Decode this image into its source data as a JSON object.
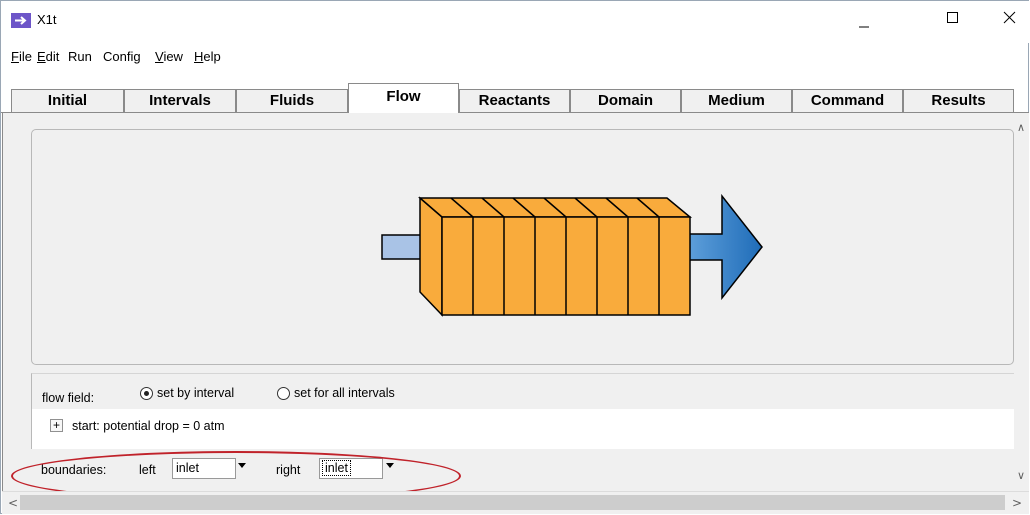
{
  "window": {
    "title": "X1t",
    "controls": {
      "minimize_icon": "minimize-icon",
      "maximize_icon": "maximize-icon",
      "close_icon": "close-icon"
    }
  },
  "menu": [
    {
      "label": "File",
      "underline": "F",
      "rest": "ile"
    },
    {
      "label": "Edit",
      "underline": "E",
      "rest": "dit"
    },
    {
      "label": "Run",
      "underline": "",
      "rest": "Run"
    },
    {
      "label": "Config",
      "underline": "",
      "rest": "Config"
    },
    {
      "label": "View",
      "underline": "V",
      "rest": "iew"
    },
    {
      "label": "Help",
      "underline": "H",
      "rest": "elp"
    }
  ],
  "tabs": [
    "Initial",
    "Intervals",
    "Fluids",
    "Flow",
    "Reactants",
    "Domain",
    "Medium",
    "Command",
    "Results"
  ],
  "active_tab": "Flow",
  "flow_field": {
    "label": "flow field:",
    "option_interval": "set by interval",
    "option_all": "set for all intervals",
    "selected": "set by interval"
  },
  "start": {
    "expand_symbol": "+",
    "text": "start:  potential drop = 0 atm"
  },
  "boundaries": {
    "label": "boundaries:",
    "left_label": "left",
    "left_value": "inlet",
    "right_label": "right",
    "right_value": "inlet"
  },
  "colors": {
    "block_fill": "#f9ab3c",
    "arrow_in": "#a9c3e6",
    "arrow_out": "#2a77c2",
    "highlight_ellipse": "#c0222a"
  },
  "diagram": {
    "interval_count": 8
  }
}
